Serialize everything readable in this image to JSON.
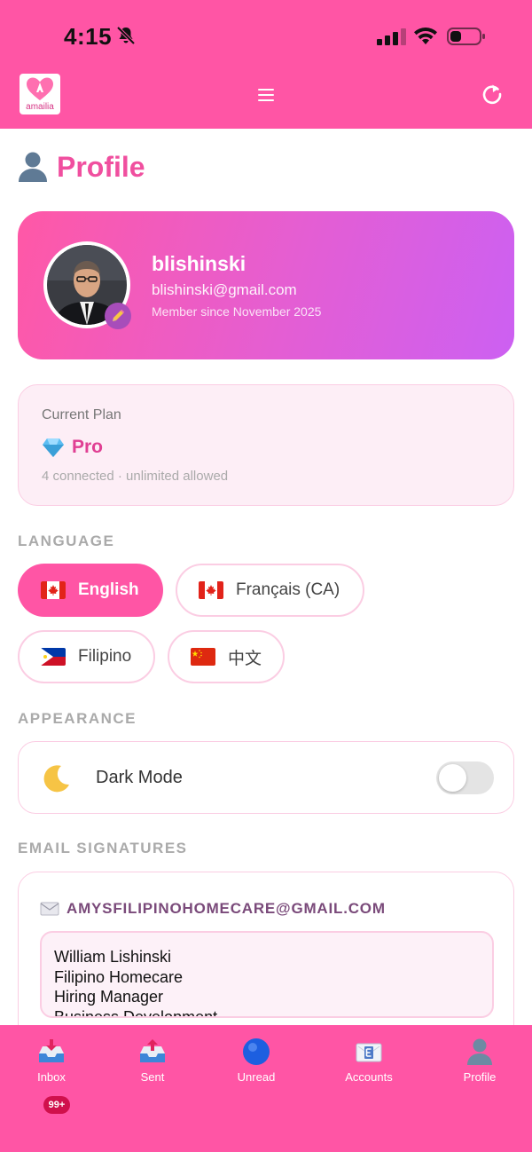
{
  "status_bar": {
    "time": "4:15"
  },
  "app_bar": {
    "logo_text": "amailia"
  },
  "page": {
    "title": "Profile"
  },
  "profile": {
    "username": "blishinski",
    "email": "blishinski@gmail.com",
    "member_since": "Member since November 2025"
  },
  "plan": {
    "label": "Current Plan",
    "name": "Pro",
    "usage": "4 connected · unlimited allowed"
  },
  "language": {
    "heading": "LANGUAGE",
    "options": [
      {
        "label": "English",
        "flag": "canada-flag",
        "selected": true
      },
      {
        "label": "Français (CA)",
        "flag": "canada-flag",
        "selected": false
      },
      {
        "label": "Filipino",
        "flag": "philippines-flag",
        "selected": false
      },
      {
        "label": "中文",
        "flag": "china-flag",
        "selected": false
      }
    ]
  },
  "appearance": {
    "heading": "APPEARANCE",
    "dark_mode_label": "Dark Mode",
    "dark_mode_on": false
  },
  "signatures": {
    "heading": "EMAIL SIGNATURES",
    "account": "AMYSFILIPINOHOMECARE@GMAIL.COM",
    "lines": [
      "William Lishinski",
      "Filipino Homecare",
      "Hiring Manager",
      "Business Development"
    ]
  },
  "tabs": [
    {
      "label": "Inbox",
      "icon": "inbox-tray-icon",
      "badge": "99+"
    },
    {
      "label": "Sent",
      "icon": "outbox-tray-icon"
    },
    {
      "label": "Unread",
      "icon": "blue-circle-icon"
    },
    {
      "label": "Accounts",
      "icon": "email-card-icon"
    },
    {
      "label": "Profile",
      "icon": "person-silhouette-icon"
    }
  ],
  "colors": {
    "brand_pink": "#ff55a5",
    "title_pink": "#f04f9f",
    "card_gradient_end": "#cc60f2",
    "border_pink": "#fbcde3"
  }
}
